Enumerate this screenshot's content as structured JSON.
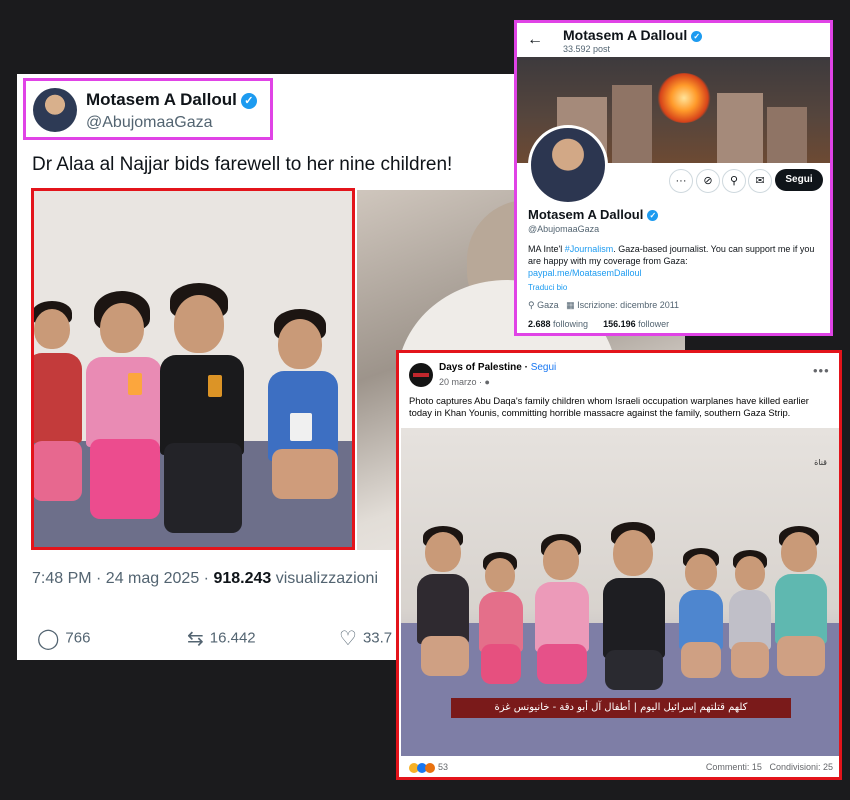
{
  "tweet": {
    "name": "Motasem A Dalloul",
    "handle": "@AbujomaaGaza",
    "text": "Dr Alaa al Najjar bids farewell to her nine children!",
    "time": "7:48 PM · 24 mag 2025 · ",
    "views_count": "918.243",
    "views_label": " visualizzazioni",
    "replies": "766",
    "retweets": "16.442",
    "likes": "33.7",
    "icons": [
      "verified-icon",
      "reply-icon",
      "retweet-icon",
      "like-icon"
    ]
  },
  "profile": {
    "name": "Motasem A Dalloul",
    "posts": "33.592 post",
    "display_name": "Motasem A Dalloul",
    "handle": "@AbujomaaGaza",
    "bio_prefix": "MA Inte'l ",
    "bio_hashtag": "#Journalism",
    "bio_rest": ". Gaza-based journalist. You can support me if you are happy with my coverage from Gaza:",
    "bio_link": "paypal.me/MoatasemDalloul",
    "translate": "Traduci bio",
    "location": "Gaza",
    "joined": "Iscrizione: dicembre 2011",
    "following_count": "2.688",
    "following_label": " following",
    "followers_count": "156.196",
    "followers_label": " follower",
    "follow_label": "Segui",
    "icons": [
      "back-arrow-icon",
      "more-icon",
      "grok-icon",
      "search-icon",
      "mail-icon",
      "location-icon",
      "calendar-icon"
    ]
  },
  "fb": {
    "page_name": "Days of Palestine",
    "separator": " · ",
    "follow_label": "Segui",
    "date": "20 marzo · ",
    "caption": "Photo captures Abu Daqa's family children whom Israeli occupation warplanes have killed earlier today in Khan Younis, committing horrible massacre against the family, southern Gaza Strip.",
    "overlay": "كلهم قتلتهم إسرائيل اليوم | أطفال آل أبو دقة - خانيونس غزة",
    "reactions_count": "53",
    "comments": "Commenti: 15",
    "shares": "Condivisioni: 25",
    "colors": {
      "red": "#e3141b",
      "magenta": "#e043e6",
      "twitter_blue": "#1d9bf0",
      "fb_blue": "#1877f2"
    }
  }
}
